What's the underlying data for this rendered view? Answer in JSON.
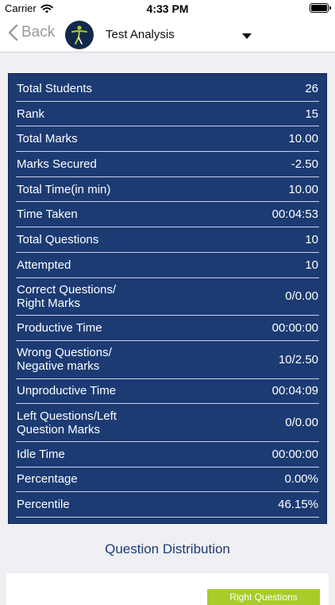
{
  "status_bar": {
    "carrier": "Carrier",
    "time": "4:33 PM"
  },
  "nav": {
    "back_label": "Back",
    "title": "Test Analysis"
  },
  "stats": [
    {
      "label": "Total Students",
      "value": "26"
    },
    {
      "label": "Rank",
      "value": "15"
    },
    {
      "label": "Total Marks",
      "value": "10.00"
    },
    {
      "label": "Marks Secured",
      "value": "-2.50"
    },
    {
      "label": "Total Time(in min)",
      "value": "10.00"
    },
    {
      "label": "Time Taken",
      "value": "00:04:53"
    },
    {
      "label": "Total Questions",
      "value": "10"
    },
    {
      "label": "Attempted",
      "value": "10"
    },
    {
      "label": "Correct Questions/\nRight Marks",
      "value": "0/0.00"
    },
    {
      "label": "Productive Time",
      "value": "00:00:00"
    },
    {
      "label": "Wrong Questions/\nNegative marks",
      "value": "10/2.50"
    },
    {
      "label": "Unproductive Time",
      "value": "00:04:09"
    },
    {
      "label": "Left Questions/Left\nQuestion Marks",
      "value": "0/0.00"
    },
    {
      "label": "Idle Time",
      "value": "00:00:00"
    },
    {
      "label": "Percentage",
      "value": "0.00%"
    },
    {
      "label": "Percentile",
      "value": "46.15%"
    }
  ],
  "section": {
    "title": "Question Distribution"
  },
  "legend": {
    "right_label": "Right Questions"
  },
  "colors": {
    "panel": "#1c3b73",
    "accent_green": "#a8cc2a"
  }
}
